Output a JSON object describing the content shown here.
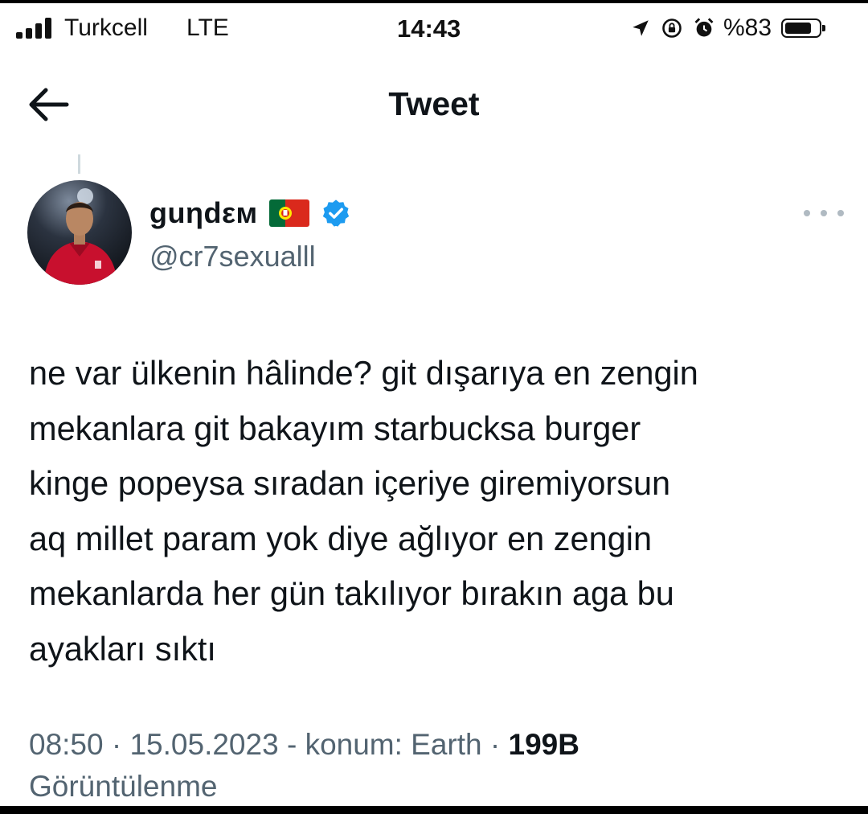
{
  "status_bar": {
    "carrier": "Turkcell",
    "network": "LTE",
    "time": "14:43",
    "battery": "%83",
    "battery_level": 0.83,
    "icons": [
      "location-arrow-icon",
      "lock-rotation-icon",
      "alarm-icon"
    ]
  },
  "header": {
    "title": "Tweet"
  },
  "author": {
    "name": "guηdεм",
    "handle": "@cr7sexualll",
    "verified": true,
    "flag": "portugal-flag-icon"
  },
  "tweet": {
    "lines": [
      "ne var ülkenin hâlinde? git dışarıya en zengin",
      "mekanlara git bakayım starbucksa burger",
      "kinge popeysa sıradan içeriye giremiyorsun",
      "aq millet param yok diye ağlıyor en zengin",
      "mekanlarda her gün takılıyor bırakın aga bu",
      "ayakları sıktı"
    ],
    "meta": {
      "time": "08:50",
      "date": "15.05.2023",
      "location": "konum: Earth",
      "views_count": "199B",
      "views_label": "Görüntülenme"
    }
  },
  "colors": {
    "text": "#0f1419",
    "secondary": "#536471",
    "verified": "#1d9bf0"
  }
}
